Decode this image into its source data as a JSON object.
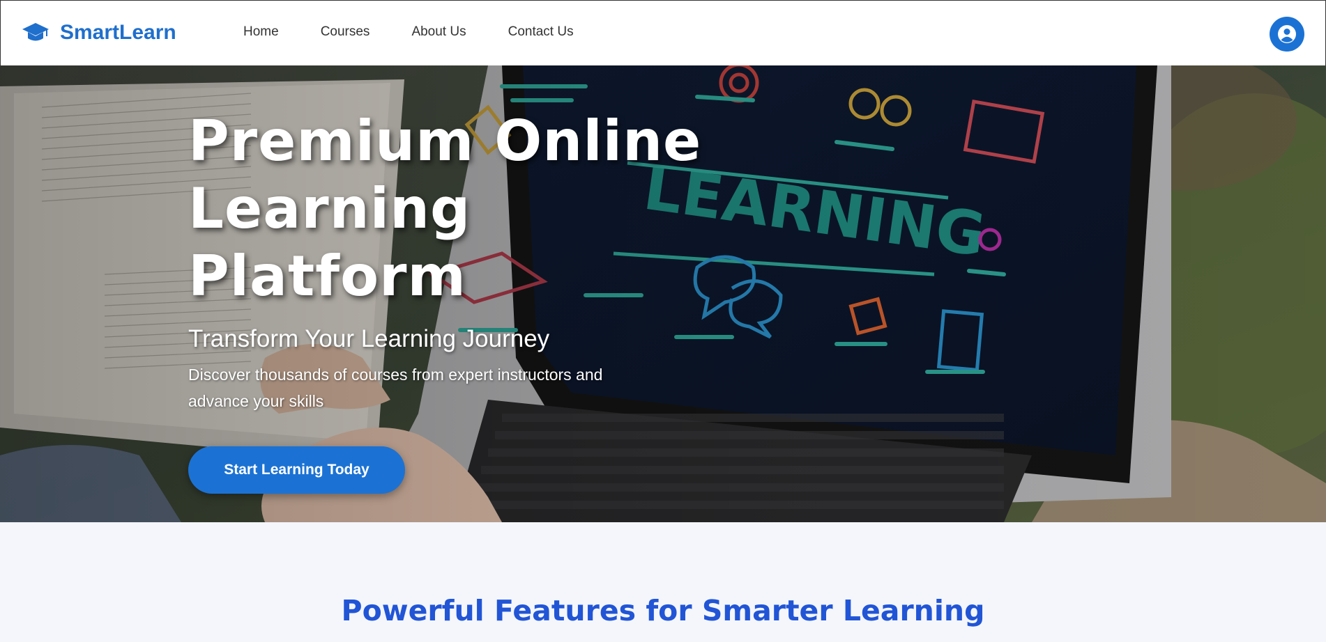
{
  "header": {
    "brand_name": "SmartLearn",
    "brand_icon": "graduation-cap-icon",
    "nav": [
      "Home",
      "Courses",
      "About Us",
      "Contact Us"
    ],
    "profile_icon": "user-circle-icon"
  },
  "hero": {
    "title": "Premium Online Learning Platform",
    "subtitle": "Transform Your Learning Journey",
    "description": "Discover thousands of courses from expert instructors and advance your skills",
    "cta_label": "Start Learning Today",
    "screen_text": "LEARNING"
  },
  "features": {
    "title": "Powerful Features for Smarter Learning"
  },
  "colors": {
    "brand": "#1f6fcc",
    "primary_button": "#1b72d4",
    "features_title": "#2155d6",
    "features_bg": "#f4f6fb"
  }
}
